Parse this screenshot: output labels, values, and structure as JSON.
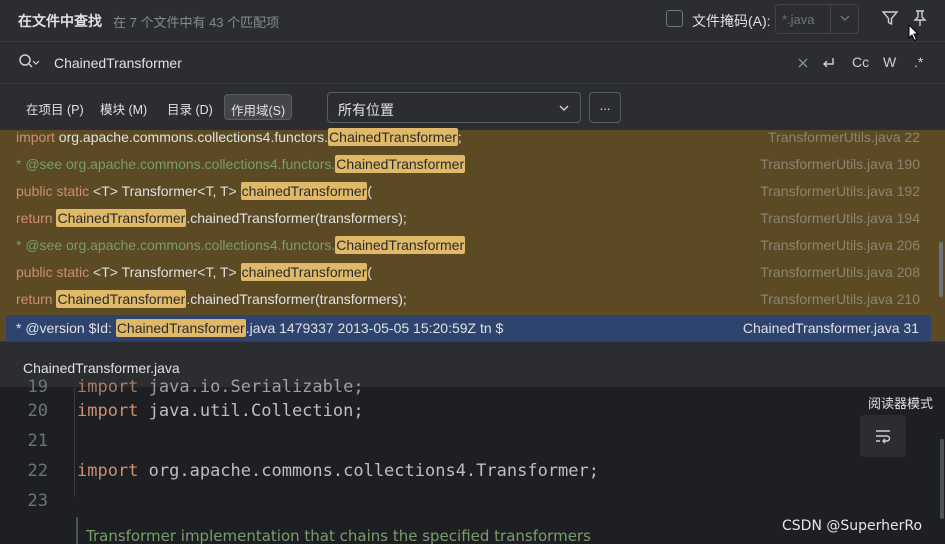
{
  "header": {
    "title": "在文件中查找",
    "subtitle": "在 7 个文件中有 43 个匹配项",
    "file_mask_label": "文件掩码(A):",
    "file_mask_value": "*.java"
  },
  "search": {
    "query": "ChainedTransformer",
    "match_case_label": "Cc",
    "words_label": "W",
    "regex_label": ".*"
  },
  "scope": {
    "tabs": [
      {
        "label": "在项目 (P)",
        "active": false
      },
      {
        "label": "模块 (M)",
        "active": false
      },
      {
        "label": "目录 (D)",
        "active": false
      },
      {
        "label": "作用域(S)",
        "active": true
      }
    ],
    "location": "所有位置",
    "more_label": "..."
  },
  "results": [
    {
      "parts": [
        {
          "t": "import ",
          "c": "kw"
        },
        {
          "t": "org.apache.commons.collections4.functors.",
          "c": "dim"
        },
        {
          "t": "ChainedTransformer",
          "c": "hl"
        },
        {
          "t": ";",
          "c": "dim"
        }
      ],
      "file": "TransformerUtils.java 22",
      "selected": false
    },
    {
      "parts": [
        {
          "t": "* @see ",
          "c": "cm"
        },
        {
          "t": "org.apache.commons.collections4.functors.",
          "c": "cm"
        },
        {
          "t": "ChainedTransformer",
          "c": "hl"
        }
      ],
      "file": "TransformerUtils.java 190",
      "selected": false
    },
    {
      "parts": [
        {
          "t": "public static ",
          "c": "kw"
        },
        {
          "t": "<T> Transformer<T, T> ",
          "c": "dim"
        },
        {
          "t": "chainedTransformer",
          "c": "hl"
        },
        {
          "t": "(",
          "c": "dim"
        }
      ],
      "file": "TransformerUtils.java 192",
      "selected": false
    },
    {
      "parts": [
        {
          "t": "return ",
          "c": "kw"
        },
        {
          "t": "ChainedTransformer",
          "c": "hl"
        },
        {
          "t": ".chainedTransformer(transformers);",
          "c": "dim"
        }
      ],
      "file": "TransformerUtils.java 194",
      "selected": false
    },
    {
      "parts": [
        {
          "t": "* @see ",
          "c": "cm"
        },
        {
          "t": "org.apache.commons.collections4.functors.",
          "c": "cm"
        },
        {
          "t": "ChainedTransformer",
          "c": "hl"
        }
      ],
      "file": "TransformerUtils.java 206",
      "selected": false
    },
    {
      "parts": [
        {
          "t": "public static ",
          "c": "kw"
        },
        {
          "t": "<T> Transformer<T, T> ",
          "c": "dim"
        },
        {
          "t": "chainedTransformer",
          "c": "hl"
        },
        {
          "t": "(",
          "c": "dim"
        }
      ],
      "file": "TransformerUtils.java 208",
      "selected": false
    },
    {
      "parts": [
        {
          "t": "return ",
          "c": "kw"
        },
        {
          "t": "ChainedTransformer",
          "c": "hl"
        },
        {
          "t": ".chainedTransformer(transformers);",
          "c": "dim"
        }
      ],
      "file": "TransformerUtils.java 210",
      "selected": false
    },
    {
      "parts": [
        {
          "t": "* @version $Id: ",
          "c": "dim"
        },
        {
          "t": "ChainedTransformer",
          "c": "hl"
        },
        {
          "t": ".java 1479337 2013-05-05 15:20:59Z tn $",
          "c": "dim"
        }
      ],
      "file": "ChainedTransformer.java 31",
      "selected": true
    }
  ],
  "preview": {
    "file_name": "ChainedTransformer.java",
    "reader_mode_label": "阅读器模式",
    "lines": [
      {
        "num": "20",
        "kw": "import ",
        "rest": "java.util.Collection;"
      },
      {
        "num": "21",
        "kw": "",
        "rest": ""
      },
      {
        "num": "22",
        "kw": "import ",
        "rest": "org.apache.commons.collections4.Transformer;"
      },
      {
        "num": "23",
        "kw": "",
        "rest": ""
      }
    ],
    "doc_comment": "Transformer implementation that chains the specified transformers"
  },
  "watermark": "CSDN @SuperherRo",
  "colors": {
    "highlight": "#e0b968",
    "result_bg": "#5b4a23",
    "selected_bg": "#2e436e",
    "keyword": "#cf8e6d",
    "comment": "#7a9d6d"
  }
}
